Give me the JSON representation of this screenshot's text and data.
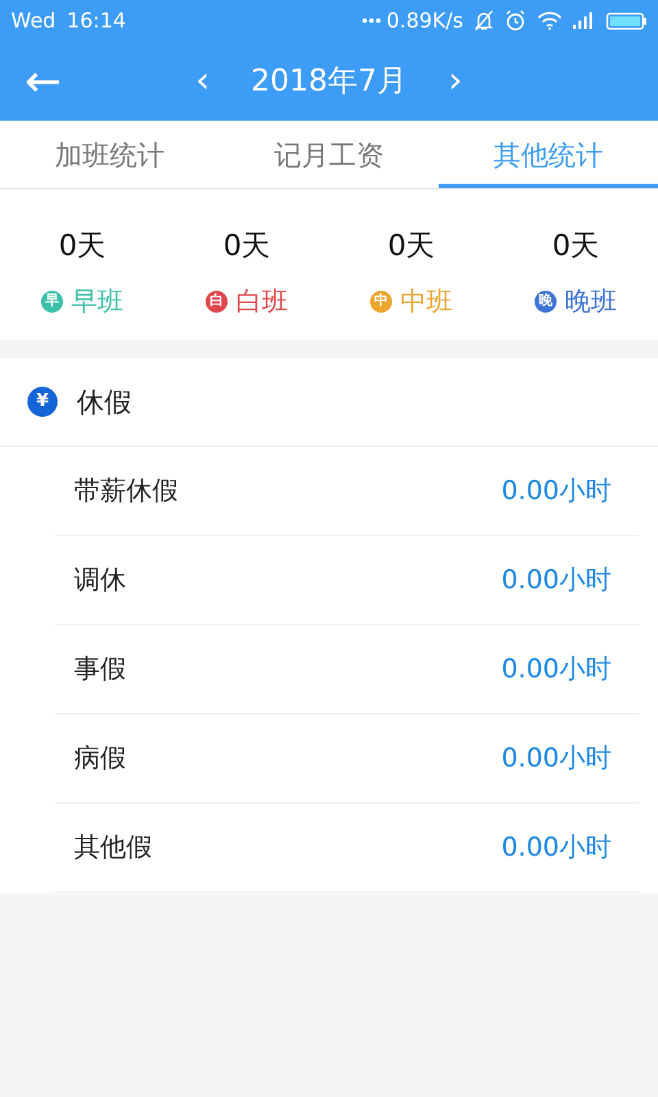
{
  "status_bar": {
    "day": "Wed",
    "time": "16:14",
    "speed": "0.89K/s"
  },
  "header": {
    "back": "←",
    "prev": "‹",
    "title": "2018年7月",
    "next": "›"
  },
  "tabs": [
    {
      "label": "加班统计",
      "selected": false
    },
    {
      "label": "记月工资",
      "selected": false
    },
    {
      "label": "其他统计",
      "selected": true
    }
  ],
  "shifts": [
    {
      "count": "0天",
      "badge": "早",
      "label": "早班",
      "color": "#3cc1a8"
    },
    {
      "count": "0天",
      "badge": "白",
      "label": "白班",
      "color": "#e0474c"
    },
    {
      "count": "0天",
      "badge": "中",
      "label": "中班",
      "color": "#eba42c"
    },
    {
      "count": "0天",
      "badge": "晚",
      "label": "晚班",
      "color": "#3d74d6"
    }
  ],
  "leave": {
    "badge": "¥",
    "title": "休假",
    "items": [
      {
        "name": "带薪休假",
        "value": "0.00小时"
      },
      {
        "name": "调休",
        "value": "0.00小时"
      },
      {
        "name": "事假",
        "value": "0.00小时"
      },
      {
        "name": "病假",
        "value": "0.00小时"
      },
      {
        "name": "其他假",
        "value": "0.00小时"
      }
    ]
  }
}
